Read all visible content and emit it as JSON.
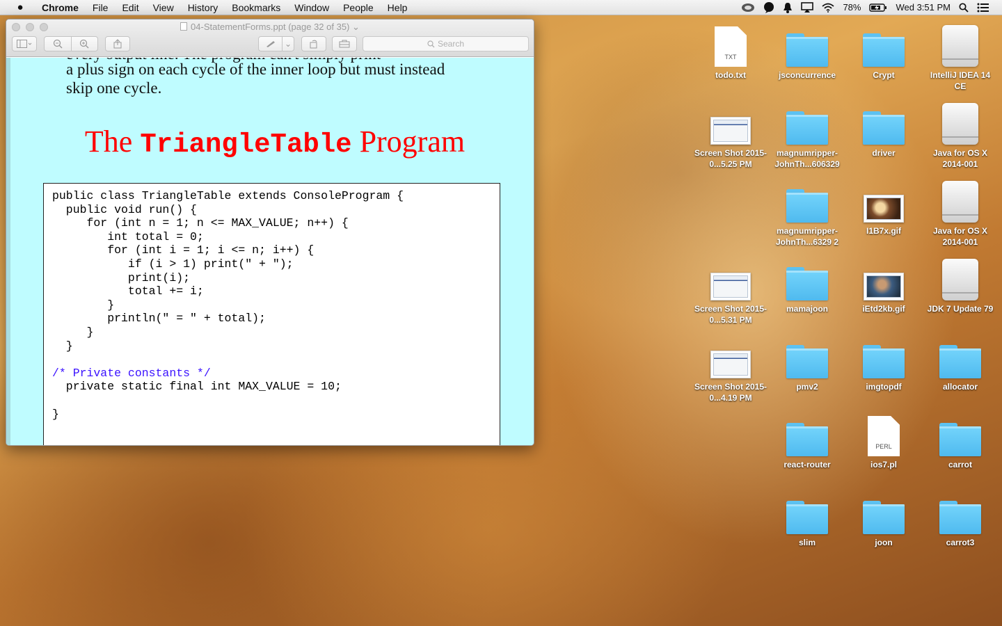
{
  "menubar": {
    "apple": "",
    "app_name": "Chrome",
    "items": [
      "File",
      "Edit",
      "View",
      "History",
      "Bookmarks",
      "Window",
      "People",
      "Help"
    ],
    "battery": "78%",
    "clock": "Wed 3:51 PM"
  },
  "window": {
    "title": "04-StatementForms.ppt (page 32 of 35)",
    "search_placeholder": "Search"
  },
  "slide": {
    "prev_line_cut": "every output line. The program can't simply print",
    "prev_line_1": "a plus sign on each cycle of the inner loop but must instead",
    "prev_line_2": "skip one cycle.",
    "heading_prefix": "The ",
    "heading_code": "TriangleTable",
    "heading_suffix": " Program",
    "code_lines": [
      "public class TriangleTable extends ConsoleProgram {",
      "",
      "  public void run() {",
      "     for (int n = 1; n <= MAX_VALUE; n++) {",
      "        int total = 0;",
      "        for (int i = 1; i <= n; i++) {",
      "           if (i > 1) print(\" + \");",
      "           print(i);",
      "           total += i;",
      "        }",
      "        println(\" = \" + total);",
      "     }",
      "  }",
      "",
      "/* Private constants */",
      "  private static final int MAX_VALUE = 10;",
      "",
      "}"
    ]
  },
  "desktop": {
    "icons": [
      {
        "label": "todo.txt",
        "icon": "txt-file-icon",
        "ext": "TXT"
      },
      {
        "label": "jsconcurrence",
        "icon": "folder-icon"
      },
      {
        "label": "Crypt",
        "icon": "folder-icon"
      },
      {
        "label": "IntelliJ IDEA 14 CE",
        "icon": "disk-image-icon"
      },
      {
        "label": "Screen Shot 2015-0...5.25 PM",
        "icon": "screenshot-icon"
      },
      {
        "label": "magnumripper-JohnTh...606329",
        "icon": "folder-icon"
      },
      {
        "label": "driver",
        "icon": "folder-icon"
      },
      {
        "label": "Java for OS X 2014-001",
        "icon": "disk-image-icon"
      },
      {
        "label": "magnumripper-JohnTh...6329 2",
        "icon": "folder-icon"
      },
      {
        "label": "I1B7x.gif",
        "icon": "gif-image-icon"
      },
      {
        "label": "Java for OS X 2014-001",
        "icon": "disk-image-icon"
      },
      {
        "label": "Screen Shot 2015-0...5.31 PM",
        "icon": "screenshot-icon"
      },
      {
        "label": "mamajoon",
        "icon": "folder-icon"
      },
      {
        "label": "iEtd2kb.gif",
        "icon": "gif-image-icon"
      },
      {
        "label": "JDK 7 Update 79",
        "icon": "disk-image-icon"
      },
      {
        "label": "Screen Shot 2015-0...4.19 PM",
        "icon": "screenshot-icon"
      },
      {
        "label": "pmv2",
        "icon": "folder-icon"
      },
      {
        "label": "imgtopdf",
        "icon": "folder-icon"
      },
      {
        "label": "allocator",
        "icon": "folder-icon"
      },
      {
        "label": "react-router",
        "icon": "folder-icon"
      },
      {
        "label": "ios7.pl",
        "icon": "perl-file-icon",
        "ext": "PERL"
      },
      {
        "label": "carrot",
        "icon": "folder-icon"
      },
      {
        "label": "slim",
        "icon": "folder-icon"
      },
      {
        "label": "joon",
        "icon": "folder-icon"
      },
      {
        "label": "carrot3",
        "icon": "folder-icon"
      }
    ]
  }
}
